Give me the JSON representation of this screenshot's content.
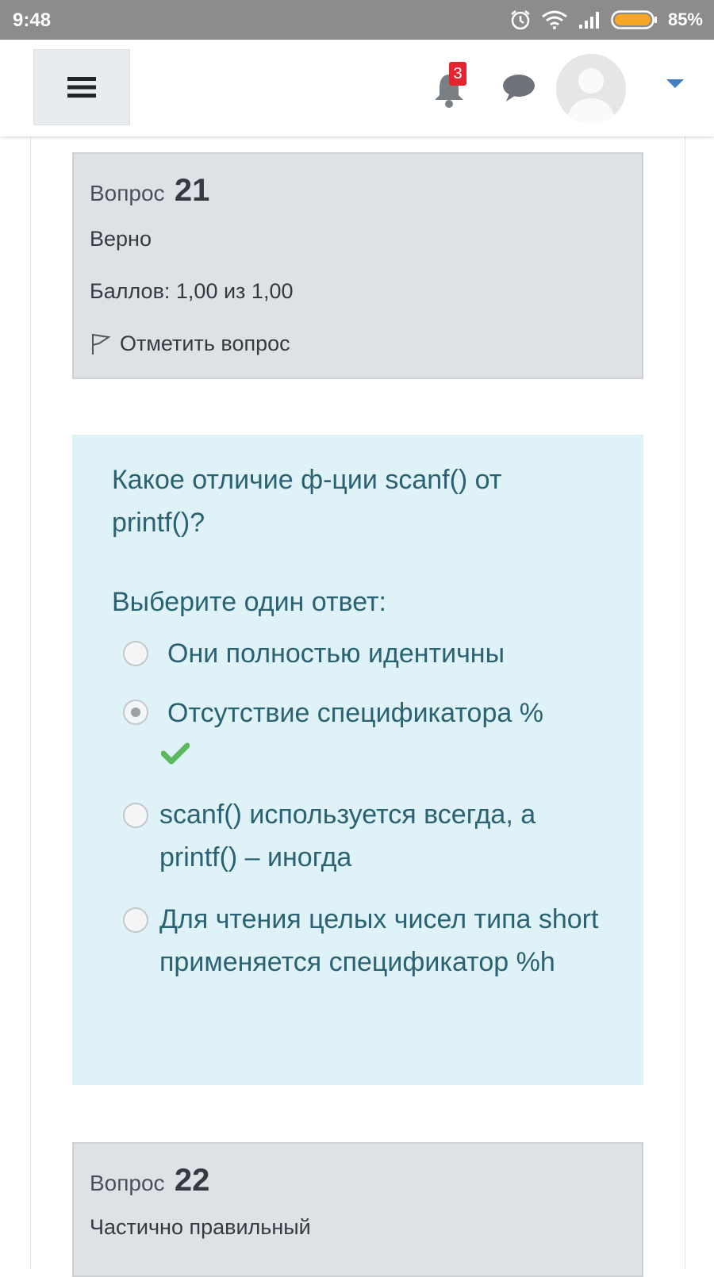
{
  "status_bar": {
    "time": "9:48",
    "battery": "85%",
    "icons": [
      "alarm-icon",
      "wifi-icon",
      "signal-icon",
      "battery-icon"
    ]
  },
  "navbar": {
    "menu_icon": "hamburger-icon",
    "notifications_count": "3",
    "notification_icon": "bell-icon",
    "messages_icon": "chat-icon",
    "user_icon": "avatar",
    "dropdown_icon": "caret-down-icon"
  },
  "question21": {
    "label": "Вопрос",
    "number": "21",
    "state": "Верно",
    "grade": "Баллов: 1,00 из 1,00",
    "flag_label": "Отметить вопрос"
  },
  "formulation": {
    "question_text": "Какое отличие ф-ции scanf() от printf()?",
    "prompt": "Выберите один ответ:",
    "answers": [
      {
        "text": "Они полностью идентичны",
        "selected": false,
        "correct": false
      },
      {
        "text": "Отсутствие спецификатора %",
        "selected": true,
        "correct": true
      },
      {
        "text": "scanf() используется всегда, а printf() – иногда",
        "selected": false,
        "correct": false
      },
      {
        "text": "Для чтения целых чисел типа short применяется спецификатор %h",
        "selected": false,
        "correct": false
      }
    ]
  },
  "question22": {
    "label": "Вопрос",
    "number": "22",
    "state": "Частично правильный"
  },
  "colors": {
    "info_bg": "#dee2e6",
    "formulation_bg": "#def2f8",
    "formulation_text": "#2a6272",
    "correct_check": "#5cb85c",
    "badge": "#e4252f",
    "caret": "#3f7fc2"
  }
}
